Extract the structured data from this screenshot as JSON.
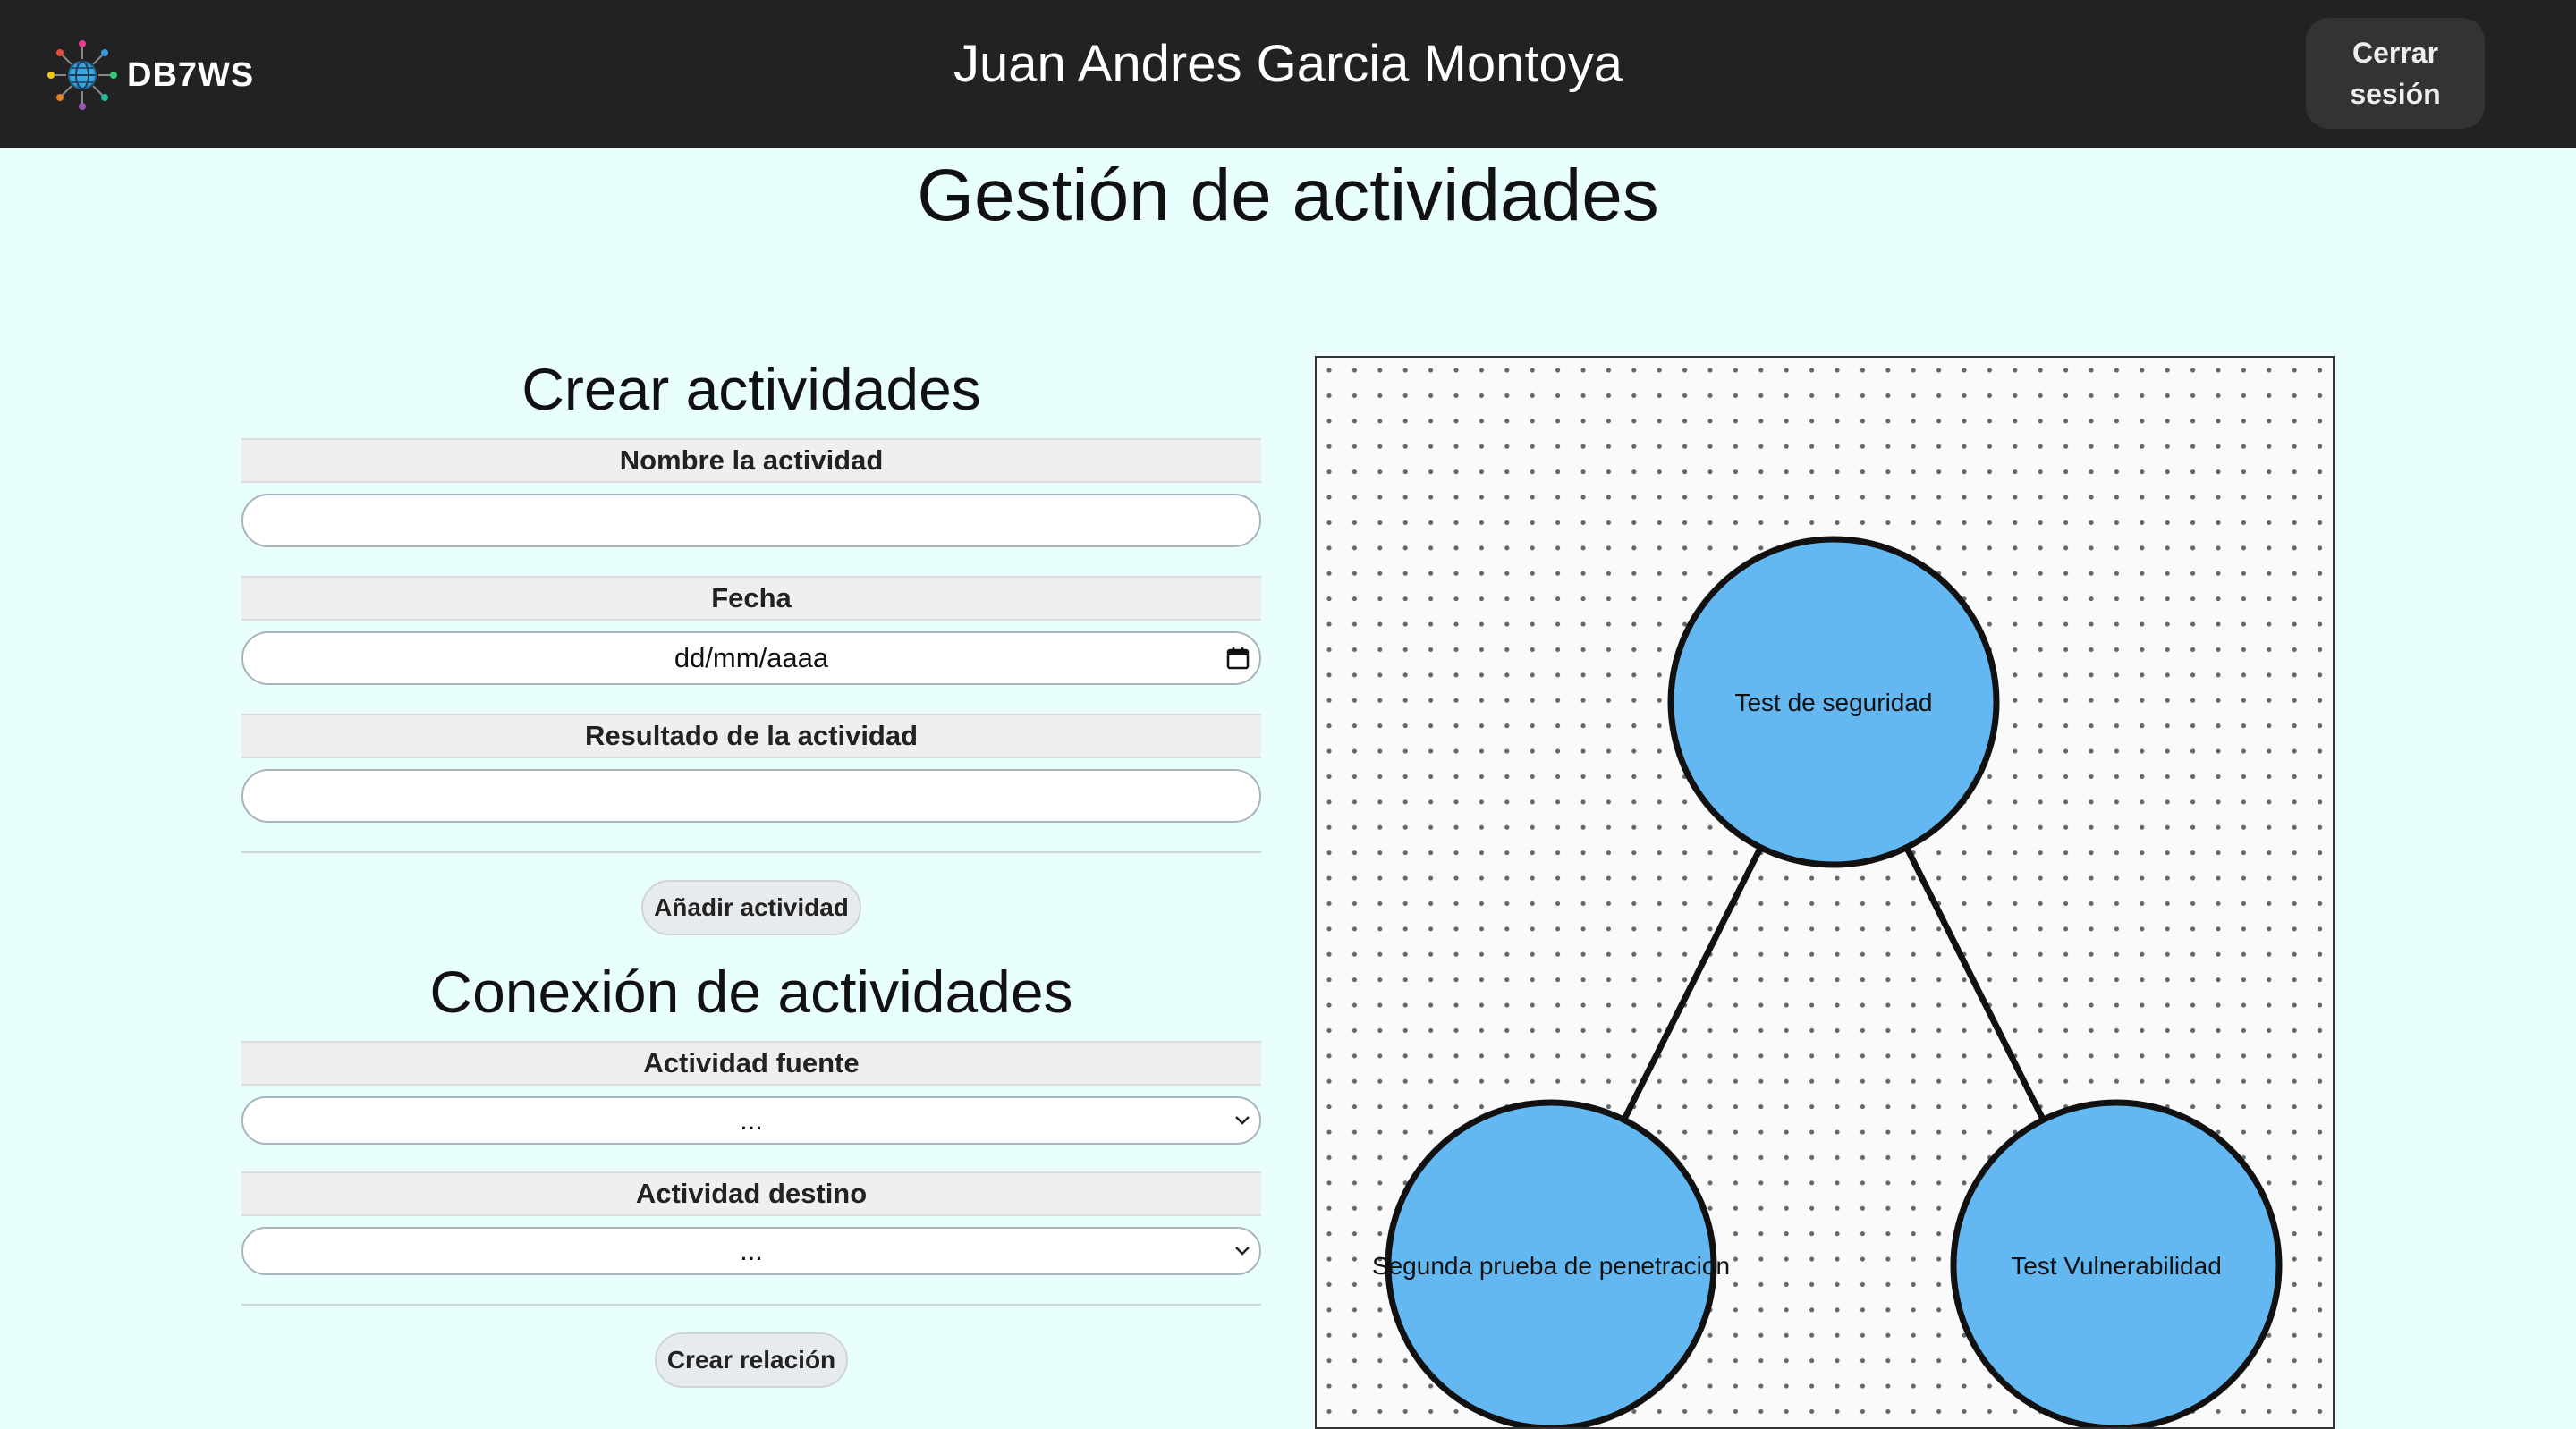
{
  "header": {
    "brand": "DB7WS",
    "user_name": "Juan Andres Garcia Montoya",
    "logout_label": "Cerrar\nsesión"
  },
  "page_title": "Gestión de actividades",
  "create_section": {
    "title": "Crear actividades",
    "name_label": "Nombre la actividad",
    "name_value": "",
    "date_label": "Fecha",
    "date_placeholder": "dd/mm/aaaa",
    "result_label": "Resultado de la actividad",
    "result_value": "",
    "add_button": "Añadir actividad"
  },
  "connect_section": {
    "title": "Conexión de actividades",
    "source_label": "Actividad fuente",
    "source_selected": "...",
    "target_label": "Actividad destino",
    "target_selected": "...",
    "create_button": "Crear relación"
  },
  "graph": {
    "node_color": "#63b8f2",
    "nodes": [
      {
        "id": "n1",
        "label": "Test de seguridad"
      },
      {
        "id": "n2",
        "label": "Segunda prueba de penetracion"
      },
      {
        "id": "n3",
        "label": "Test Vulnerabilidad"
      }
    ],
    "edges": [
      {
        "from": "n1",
        "to": "n2"
      },
      {
        "from": "n1",
        "to": "n3"
      }
    ]
  }
}
